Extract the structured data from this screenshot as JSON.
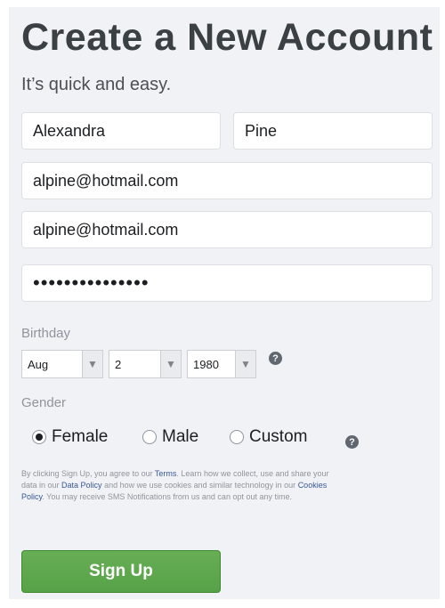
{
  "header": {
    "title": "Create a New Account",
    "subtitle": "It’s quick and easy."
  },
  "form": {
    "first_name": "Alexandra",
    "last_name": "Pine",
    "email": "alpine@hotmail.com",
    "email_confirm": "alpine@hotmail.com",
    "password_mask": "•••••••••••••••"
  },
  "birthday": {
    "label": "Birthday",
    "month": "Aug",
    "day": "2",
    "year": "1980",
    "help_icon": "question-circle-icon"
  },
  "gender": {
    "label": "Gender",
    "options": [
      "Female",
      "Male",
      "Custom"
    ],
    "selected": "Female",
    "help_icon": "question-circle-icon"
  },
  "terms": {
    "part1": "By clicking Sign Up, you agree to our ",
    "terms_link": "Terms",
    "part2": ". Learn how we collect, use and share your data in our ",
    "data_policy_link": "Data Policy",
    "part3": " and how we use cookies and similar technology in our ",
    "cookies_policy_link": "Cookies Policy",
    "part4": ". You may receive SMS Notifications from us and can opt out any time."
  },
  "actions": {
    "signup_label": "Sign Up"
  },
  "colors": {
    "background": "#f0f2f5",
    "button": "#5ea84e",
    "link": "#385898"
  }
}
